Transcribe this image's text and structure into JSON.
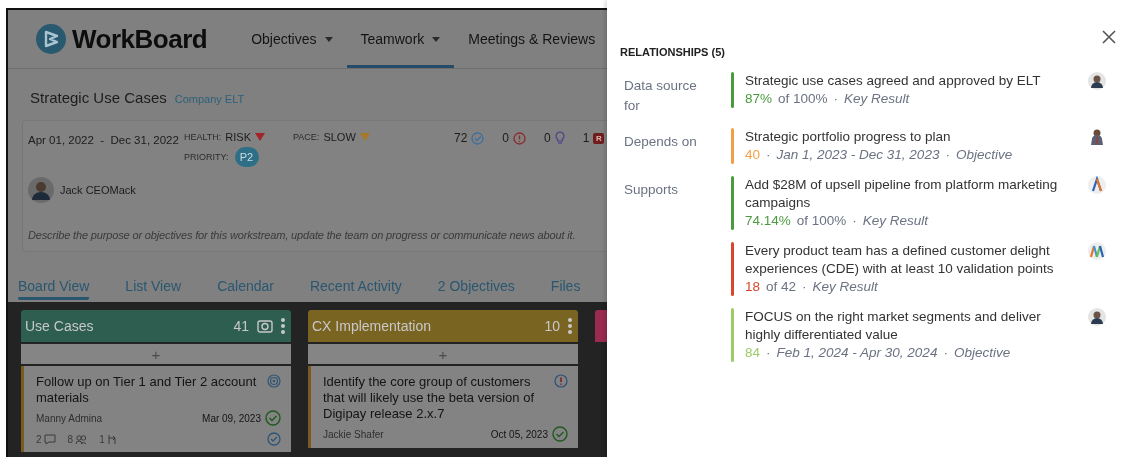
{
  "app": {
    "logo": "WorkBoard",
    "nav": [
      {
        "label": "Objectives",
        "dropdown": true,
        "selected": false
      },
      {
        "label": "Teamwork",
        "dropdown": true,
        "selected": true
      },
      {
        "label": "Meetings & Reviews",
        "dropdown": false,
        "selected": false
      }
    ]
  },
  "workstream": {
    "title": "Strategic Use Cases",
    "team": "Company ELT",
    "dates": "Apr 01, 2022  -  Dec 31, 2022",
    "status": [
      {
        "label": "HEALTH:",
        "value": "RISK",
        "color": "#a3232a"
      },
      {
        "label": "PACE:",
        "value": "SLOW",
        "color": "#a8782a"
      }
    ],
    "priority": {
      "label": "PRIORITY:",
      "value": "P2"
    },
    "counts": [
      {
        "value": "72",
        "kind": "check"
      },
      {
        "value": "0",
        "kind": "alert"
      },
      {
        "value": "0",
        "kind": "idea"
      },
      {
        "value": "1",
        "kind": "badge",
        "badge": "R"
      }
    ],
    "owner": "Jack CEOMack",
    "description": "Describe the purpose or objectives for this workstream, update the team on progress or communicate news about it."
  },
  "tabs": [
    {
      "label": "Board View",
      "selected": true
    },
    {
      "label": "List View",
      "selected": false
    },
    {
      "label": "Calendar",
      "selected": false
    },
    {
      "label": "Recent Activity",
      "selected": false
    },
    {
      "label": "2 Objectives",
      "selected": false
    },
    {
      "label": "Files",
      "selected": false
    }
  ],
  "board": {
    "add_label": "+",
    "columns": [
      {
        "title": "Use Cases",
        "count": "41",
        "color": "#2d5e50",
        "camera": true,
        "cards": [
          {
            "title": "Follow up on Tier 1 and Tier 2 account materials",
            "kind": "target",
            "owner": "Manny Admina",
            "date": "Mar 09, 2023",
            "stats": [
              {
                "value": "2",
                "kind": "comment"
              },
              {
                "value": "8",
                "kind": "people"
              },
              {
                "value": "1",
                "kind": "branch"
              }
            ]
          }
        ]
      },
      {
        "title": "CX Implementation",
        "count": "10",
        "color": "#7a6422",
        "camera": false,
        "cards": [
          {
            "title": "Identify the core group of customers that will likely use the beta version of Digipay release 2.x.7",
            "kind": "alert",
            "owner": "Jackie Shafer",
            "date": "Oct 05, 2023"
          }
        ]
      },
      {
        "color": "#9a2a50",
        "camera": false
      }
    ]
  },
  "panel": {
    "title": "RELATIONSHIPS (5)",
    "groups": [
      {
        "label": "Data source for",
        "items": [
          {
            "title": "Strategic use cases agreed and approved by ELT",
            "color": "#4a9b3e",
            "kind": "person",
            "meta": [
              {
                "text": "87%",
                "kind": "score"
              },
              {
                "text": "of 100%",
                "kind": "plain"
              },
              {
                "text": "·",
                "kind": "sep"
              },
              {
                "text": "Key Result",
                "kind": "type"
              }
            ]
          }
        ]
      },
      {
        "label": "Depends on",
        "items": [
          {
            "title": "Strategic portfolio progress to plan",
            "color": "#f2a048",
            "kind": "figure",
            "meta": [
              {
                "text": "40",
                "kind": "score"
              },
              {
                "text": "·",
                "kind": "sep"
              },
              {
                "text": "Jan 1, 2023 - Dec 31, 2023",
                "kind": "type"
              },
              {
                "text": "·",
                "kind": "sep"
              },
              {
                "text": "Objective",
                "kind": "type"
              }
            ]
          }
        ]
      },
      {
        "label": "Supports",
        "items": [
          {
            "title": "Add $28M of upsell pipeline from platform marketing campaigns",
            "color": "#4a9b3e",
            "kind": "a-logo",
            "meta": [
              {
                "text": "74.14%",
                "kind": "score"
              },
              {
                "text": "of 100%",
                "kind": "plain"
              },
              {
                "text": "·",
                "kind": "sep"
              },
              {
                "text": "Key Result",
                "kind": "type"
              }
            ]
          },
          {
            "title": "Every product team has a defined customer delight experiences (CDE) with at least 10 validation points",
            "color": "#d8472b",
            "kind": "m-logo",
            "meta": [
              {
                "text": "18",
                "kind": "score"
              },
              {
                "text": "of 42",
                "kind": "plain"
              },
              {
                "text": "·",
                "kind": "sep"
              },
              {
                "text": "Key Result",
                "kind": "type"
              }
            ]
          },
          {
            "title": "FOCUS on the right market segments and deliver highly differentiated value",
            "color": "#9ccc66",
            "kind": "person",
            "meta": [
              {
                "text": "84",
                "kind": "score"
              },
              {
                "text": "·",
                "kind": "sep"
              },
              {
                "text": "Feb 1, 2024 - Apr 30, 2024",
                "kind": "type"
              },
              {
                "text": "·",
                "kind": "sep"
              },
              {
                "text": "Objective",
                "kind": "type"
              }
            ]
          }
        ]
      }
    ]
  }
}
